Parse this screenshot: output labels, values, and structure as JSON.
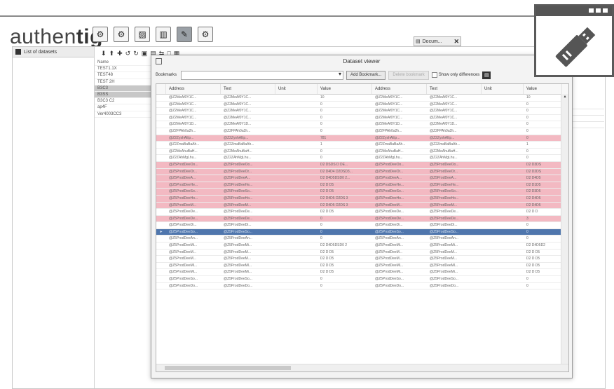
{
  "brand": {
    "prefix": "authen",
    "suffix": "tig"
  },
  "top_icons": [
    "gear-icon",
    "gear-icon",
    "image-icon",
    "chart-icon",
    "pen-icon",
    "settings-icon"
  ],
  "mini_tab": {
    "label": "Docum..."
  },
  "left_panel": {
    "title": "List of datasets"
  },
  "side_list": {
    "items": [
      "Name",
      "TEST1.1X",
      "TEST48",
      "TEST 2H",
      "B3C3",
      "B3SS",
      "B3C3 C2",
      "ap4F",
      "Ver4003CC3"
    ],
    "selected_index": 5
  },
  "dialog": {
    "title": "Dataset viewer",
    "bookmarks_label": "Bookmarks",
    "add_bookmark_label": "Add Bookmark...",
    "delete_bookmark_label": "Delete bookmark",
    "show_diff_label": "Show only differences",
    "columns": [
      "Address",
      "Text",
      "Unit",
      "Value",
      "Address",
      "Text",
      "Unit",
      "Value"
    ]
  },
  "rows": [
    {
      "state": "normal",
      "cells": [
        "@Z2MeAf0Y1C...",
        "@Z2MeAf0Y1C...",
        "",
        "10",
        "@Z2MeAf0Y1C...",
        "@Z2MeAf0Y1C...",
        "",
        "10"
      ]
    },
    {
      "state": "normal",
      "cells": [
        "@Z2MeAf0Y1C...",
        "@Z2MeAf0Y1C...",
        "",
        "0",
        "@Z2MeAf0Y1C...",
        "@Z2MeAf0Y1C...",
        "",
        "0"
      ]
    },
    {
      "state": "normal",
      "cells": [
        "@Z2MeAf0Y1C...",
        "@Z2MeAf0Y1C...",
        "",
        "0",
        "@Z2MeAf0Y1C...",
        "@Z2MeAf0Y1C...",
        "",
        "0"
      ]
    },
    {
      "state": "normal",
      "cells": [
        "@Z2MeAf0Y1C...",
        "@Z2MeAf0Y1C...",
        "",
        "0",
        "@Z2MeAf0Y1C...",
        "@Z2MeAf0Y1C...",
        "",
        "0"
      ]
    },
    {
      "state": "normal",
      "cells": [
        "@Z2MeAf0Y1D...",
        "@Z2MeAf0Y1D...",
        "",
        "0",
        "@Z2MeAf0Y1D...",
        "@Z2MeAf0Y1D...",
        "",
        "0"
      ]
    },
    {
      "state": "normal",
      "cells": [
        "@Z2FPAh0a2h...",
        "@Z2FPAh0a2h...",
        "",
        "0",
        "@Z2FPAh0a2h...",
        "@Z2FPAh0a2h...",
        "",
        "0"
      ]
    },
    {
      "state": "pink",
      "cells": [
        "@Z2ZyshAEp...",
        "@Z2ZyshAEp...",
        "",
        "781",
        "@Z2ZyshAEp...",
        "@Z2ZyshAEp...",
        "",
        "0"
      ]
    },
    {
      "state": "normal",
      "cells": [
        "@Z2ZmaBaBaAh...",
        "@Z2ZmaBaBaAh...",
        "",
        "1",
        "@Z2ZmaBaBaAh...",
        "@Z2ZmaBaBaAh...",
        "",
        "1"
      ]
    },
    {
      "state": "normal",
      "cells": [
        "@Z2MeAhuBaH...",
        "@Z2MeAhuBaH...",
        "",
        "0",
        "@Z2MeAhuBaH...",
        "@Z2MeAhuBaH...",
        "",
        "0"
      ]
    },
    {
      "state": "normal",
      "cells": [
        "@Z2ZAhMgLhu...",
        "@Z2ZAhMgLhu...",
        "",
        "0",
        "@Z2ZAhMgLhu...",
        "@Z2ZAhMgLhu...",
        "",
        "0"
      ]
    },
    {
      "state": "pink",
      "cells": [
        "@Z5ProdDeeOo...",
        "@Z5ProdDeeOo...",
        "",
        "D2 DSDS D DE...",
        "@Z5ProdDeeOo...",
        "@Z5ProdDeeOo...",
        "",
        "D2 D3DS"
      ]
    },
    {
      "state": "pink",
      "cells": [
        "@Z5ProdDeeOr...",
        "@Z5ProdDeeOr...",
        "",
        "D2 D4D4 D2DSD3...",
        "@Z5ProdDeeOr...",
        "@Z5ProdDeeOr...",
        "",
        "D2 D2DS"
      ]
    },
    {
      "state": "pink",
      "cells": [
        "@Z5ProdDeeA...",
        "@Z5ProdDeeA...",
        "",
        "D2 D4D5DSD0 2...",
        "@Z5ProdDeeA...",
        "@Z5ProdDeeA...",
        "",
        "D2 D4D5"
      ]
    },
    {
      "state": "pink",
      "cells": [
        "@Z5ProdDeeHe...",
        "@Z5ProdDeeHe...",
        "",
        "D2 D D5",
        "@Z5ProdDeeHe...",
        "@Z5ProdDeeHe...",
        "",
        "D2 D1D5"
      ]
    },
    {
      "state": "pink",
      "cells": [
        "@Z5ProdDeeSo...",
        "@Z5ProdDeeSo...",
        "",
        "D2 D D5",
        "@Z5ProdDeeSo...",
        "@Z5ProdDeeSo...",
        "",
        "D2 D3D5"
      ]
    },
    {
      "state": "pink",
      "cells": [
        "@Z5ProdDeeHo...",
        "@Z5ProdDeeHo...",
        "",
        "D2 D4D5 D2DS 3",
        "@Z5ProdDeeHo...",
        "@Z5ProdDeeHo...",
        "",
        "D2 D4D5"
      ]
    },
    {
      "state": "pink",
      "cells": [
        "@Z5ProdDeeM...",
        "@Z5ProdDeeM...",
        "",
        "D2 D4D5 D2DS 3",
        "@Z5ProdDeeM...",
        "@Z5ProdDeeM...",
        "",
        "D2 D4D5"
      ]
    },
    {
      "state": "normal",
      "cells": [
        "@Z5ProdDeeDe...",
        "@Z5ProdDeeDe...",
        "",
        "D2 D D5",
        "@Z5ProdDeeDe...",
        "@Z5ProdDeeDe...",
        "",
        "D2 D D"
      ]
    },
    {
      "state": "pink",
      "cells": [
        "@Z5ProdDeeDe...",
        "@Z5ProdDeeDe...",
        "",
        "0",
        "@Z5ProdDeeDe...",
        "@Z5ProdDeeDe...",
        "",
        "3"
      ]
    },
    {
      "state": "normal",
      "cells": [
        "@Z5ProdDeeDi...",
        "@Z5ProdDeeDi...",
        "",
        "0",
        "@Z5ProdDeeDi...",
        "@Z5ProdDeeDi...",
        "",
        "0"
      ]
    },
    {
      "state": "blue",
      "cells": [
        "@Z5ProdDeeSo...",
        "@Z5ProdDeeSo...",
        "",
        "0",
        "@Z5ProdDeeSo...",
        "@Z5ProdDeeSo...",
        "",
        "0"
      ]
    },
    {
      "state": "normal",
      "cells": [
        "@Z5ProdDeeAn...",
        "@Z5ProdDeeAn...",
        "",
        "0",
        "@Z5ProdDeeAn...",
        "@Z5ProdDeeAn...",
        "",
        "0"
      ]
    },
    {
      "state": "normal",
      "cells": [
        "@Z5ProdDeeMi...",
        "@Z5ProdDeeMi...",
        "",
        "D2 D4D5DSD0 2",
        "@Z5ProdDeeMi...",
        "@Z5ProdDeeMi...",
        "",
        "D2 D4D5D2"
      ]
    },
    {
      "state": "normal",
      "cells": [
        "@Z5ProdDeeM...",
        "@Z5ProdDeeM...",
        "",
        "D2 D D5",
        "@Z5ProdDeeM...",
        "@Z5ProdDeeM...",
        "",
        "D2 D D5"
      ]
    },
    {
      "state": "normal",
      "cells": [
        "@Z5ProdDeeM...",
        "@Z5ProdDeeM...",
        "",
        "D2 D D5",
        "@Z5ProdDeeM...",
        "@Z5ProdDeeM...",
        "",
        "D2 D D5"
      ]
    },
    {
      "state": "normal",
      "cells": [
        "@Z5ProdDeeMl...",
        "@Z5ProdDeeMl...",
        "",
        "D2 D D5",
        "@Z5ProdDeeMl...",
        "@Z5ProdDeeMl...",
        "",
        "D2 D D5"
      ]
    },
    {
      "state": "normal",
      "cells": [
        "@Z5ProdDeeMi...",
        "@Z5ProdDeeMi...",
        "",
        "D2 D D5",
        "@Z5ProdDeeMi...",
        "@Z5ProdDeeMi...",
        "",
        "D2 D D5"
      ]
    },
    {
      "state": "normal",
      "cells": [
        "@Z5ProdDeeSo...",
        "@Z5ProdDeeSo...",
        "",
        "0",
        "@Z5ProdDeeSo...",
        "@Z5ProdDeeSo...",
        "",
        "0"
      ]
    },
    {
      "state": "normal",
      "cells": [
        "@Z5ProdDeeDo...",
        "@Z5ProdDeeDo...",
        "",
        "0",
        "@Z5ProdDeeDo...",
        "@Z5ProdDeeDo...",
        "",
        "0"
      ]
    }
  ],
  "colors": {
    "diff_row": "#f3b9c2",
    "selected_row": "#4f76ad",
    "badge_dark": "#555555"
  },
  "usb_badge": {
    "icon": "usb-stick-icon"
  }
}
